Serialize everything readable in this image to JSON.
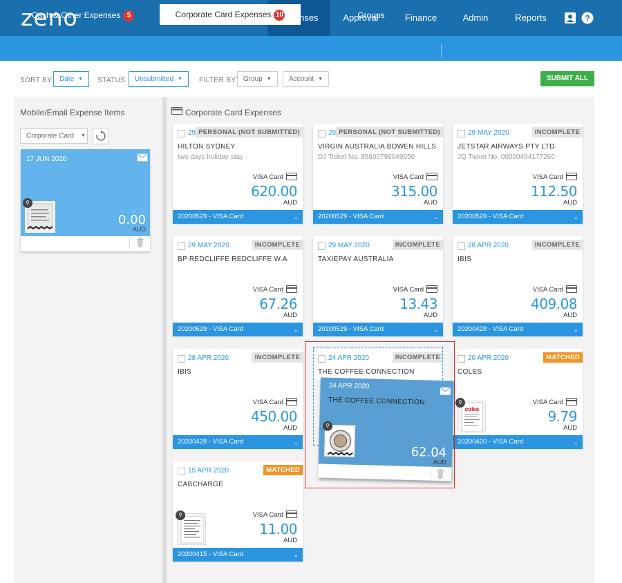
{
  "app": {
    "logo": "zeno"
  },
  "nav": {
    "items": [
      {
        "label": "Expenses",
        "active": true
      },
      {
        "label": "Approval"
      },
      {
        "label": "Finance"
      },
      {
        "label": "Admin"
      },
      {
        "label": "Reports"
      }
    ],
    "icons": [
      "user-icon",
      "help-icon"
    ]
  },
  "subnav": {
    "tabs": [
      {
        "label": "Cash & Other Expenses",
        "badge": "5"
      },
      {
        "label": "Corporate Card Expenses",
        "badge": "10",
        "active": true
      },
      {
        "label": "Groups"
      }
    ]
  },
  "filters": {
    "sort_by_label": "SORT BY",
    "sort_by_value": "Date",
    "status_label": "STATUS",
    "status_value": "Unsubmitted",
    "filter_by_label": "FILTER BY",
    "group_label": "Group",
    "account_label": "Account",
    "submit_all": "SUBMIT ALL"
  },
  "left": {
    "title": "Mobile/Email Expense Items",
    "select": "Corporate Card",
    "card": {
      "date": "17 JUN 2020",
      "amount": "0.00",
      "currency": "AUD"
    }
  },
  "right": {
    "title": "Corporate Card Expenses",
    "cards": [
      {
        "date": "29 MAY 2020",
        "status": "PERSONAL (NOT SUBMITTED)",
        "status_color": "grey",
        "merchant": "HILTON SYDNEY",
        "desc": "two days holiday stay",
        "card_label": "VISA Card",
        "amount": "620.00",
        "currency": "AUD",
        "group": "20200529 - VISA Card"
      },
      {
        "date": "29 MAY 2020",
        "status": "PERSONAL (NOT SUBMITTED)",
        "status_color": "grey",
        "merchant": "VIRGIN AUSTRALIA BOWEN HILLS",
        "desc": "DJ Ticket No. 85600796049950",
        "card_label": "VISA Card",
        "amount": "315.00",
        "currency": "AUD",
        "group": "20200529 - VISA Card"
      },
      {
        "date": "29 MAY 2020",
        "status": "INCOMPLETE",
        "status_color": "grey",
        "merchant": "JETSTAR AIRWAYS PTY LTD",
        "desc": "JQ Ticket No. 00000494177260",
        "card_label": "VISA Card",
        "amount": "112.50",
        "currency": "AUD",
        "group": "20200529 - VISA Card"
      },
      {
        "date": "29 MAY 2020",
        "status": "INCOMPLETE",
        "status_color": "grey",
        "merchant": "BP REDCLIFFE REDCLIFFE W.A",
        "desc": "",
        "card_label": "VISA Card",
        "amount": "67.26",
        "currency": "AUD",
        "group": "20200529 - VISA Card"
      },
      {
        "date": "29 MAY 2020",
        "status": "INCOMPLETE",
        "status_color": "grey",
        "merchant": "TAXIEPAY AUSTRALIA",
        "desc": "",
        "card_label": "VISA Card",
        "amount": "13.43",
        "currency": "AUD",
        "group": "20200529 - VISA Card"
      },
      {
        "date": "28 APR 2020",
        "status": "INCOMPLETE",
        "status_color": "grey",
        "merchant": "IBIS",
        "desc": "",
        "card_label": "VISA Card",
        "amount": "409.08",
        "currency": "AUD",
        "group": "20200428 - VISA Card"
      },
      {
        "date": "28 APR 2020",
        "status": "INCOMPLETE",
        "status_color": "grey",
        "merchant": "IBIS",
        "desc": "",
        "card_label": "VISA Card",
        "amount": "450.00",
        "currency": "AUD",
        "group": "20200428 - VISA Card"
      },
      {
        "date": "24 APR 2020",
        "status": "INCOMPLETE",
        "status_color": "grey",
        "merchant": "THE COFFEE CONNECTION",
        "desc": "",
        "card_label": "",
        "amount": "",
        "currency": "",
        "group": ""
      },
      {
        "date": "20 APR 2020",
        "status": "MATCHED",
        "status_color": "orange",
        "merchant": "COLES",
        "desc": "",
        "card_label": "VISA Card",
        "amount": "9.79",
        "currency": "AUD",
        "group": "20200420 - VISA Card",
        "receipt": true
      },
      {
        "date": "15 APR 2020",
        "status": "MATCHED",
        "status_color": "orange",
        "merchant": "CABCHARGE",
        "desc": "",
        "card_label": "VISA Card",
        "amount": "11.00",
        "currency": "AUD",
        "group": "20200415 - VISA Card",
        "receipt": true
      }
    ],
    "drag_card": {
      "date": "24 APR 2020",
      "merchant": "THE COFFEE CONNECTION",
      "amount": "62.04",
      "currency": "AUD"
    }
  }
}
